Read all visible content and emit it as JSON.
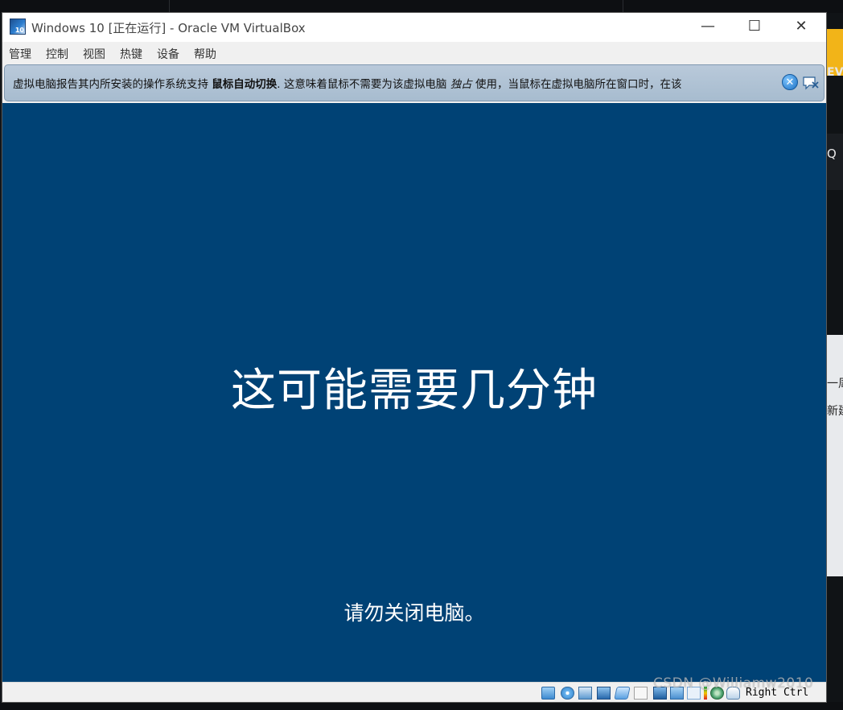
{
  "window": {
    "title": "Windows 10 [正在运行] - Oracle VM VirtualBox",
    "app_icon_badge": "10",
    "buttons": {
      "minimize": "—",
      "maximize": "☐",
      "close": "✕"
    }
  },
  "menu": {
    "items": [
      {
        "label": "管理"
      },
      {
        "label": "控制"
      },
      {
        "label": "视图"
      },
      {
        "label": "热键"
      },
      {
        "label": "设备"
      },
      {
        "label": "帮助"
      }
    ]
  },
  "notification": {
    "text_before": "虚拟电脑报告其内所安装的操作系统支持",
    "bold_text": "鼠标自动切换",
    "text_middle": ". 这意味着鼠标不需要为该虚拟电脑",
    "italic_text": "独占",
    "text_after": "使用，当鼠标在虚拟电脑所在窗口时，在该",
    "close_glyph": "✕"
  },
  "vm_screen": {
    "message": "这可能需要几分钟",
    "submessage": "请勿关闭电脑。",
    "background_color": "#004275"
  },
  "status_bar": {
    "icons": [
      "hard-disk-icon",
      "optical-drive-icon",
      "audio-icon",
      "network-icon",
      "usb-icon",
      "shared-folders-icon",
      "display-icon",
      "video-capture-icon",
      "recording-icon",
      "vt-x-icon",
      "cpu-icon",
      "mouse-integration-icon"
    ],
    "host_key": "Right Ctrl"
  },
  "desktop": {
    "side_label_ev": "EV",
    "side_label_search": "Q",
    "side_label_zhou": "一周",
    "side_label_xinjian": "新建"
  },
  "watermark": "CSDN @Williamw2010"
}
